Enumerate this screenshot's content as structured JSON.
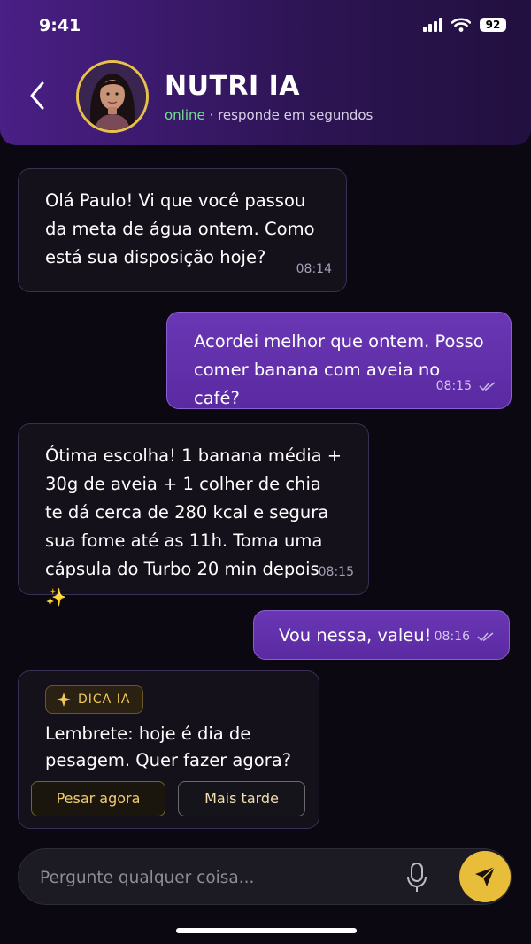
{
  "status_bar": {
    "time": "9:41",
    "battery": "92"
  },
  "header": {
    "contact_name": "NUTRI IA",
    "online_label": "online",
    "status_suffix": " · responde em segundos"
  },
  "messages": [
    {
      "sender": "ai",
      "text": "Olá Paulo! Vi que você passou da meta de água ontem. Como está sua disposição hoje?",
      "time": "08:14"
    },
    {
      "sender": "user",
      "text": "Acordei melhor que ontem. Posso comer banana com aveia no café?",
      "time": "08:15",
      "read": true
    },
    {
      "sender": "ai",
      "text": "Ótima escolha! 1 banana média + 30g de aveia + 1 colher de chia te dá cerca de 280 kcal e segura sua fome até as 11h. Toma uma cápsula do Turbo 20 min depois ✨",
      "time": "08:15"
    },
    {
      "sender": "user",
      "text": "Vou nessa, valeu!",
      "time": "08:16",
      "read": true
    }
  ],
  "tip_card": {
    "badge": "DICA IA",
    "text": "Lembrete: hoje é dia de pesagem. Quer fazer agora?",
    "primary_action": "Pesar agora",
    "secondary_action": "Mais tarde"
  },
  "composer": {
    "placeholder": "Pergunte qualquer coisa..."
  },
  "colors": {
    "accent_purple": "#5f2fa8",
    "accent_gold": "#e8bd3a",
    "online_green": "#6fe08e",
    "background": "#0b0812"
  },
  "icons": [
    "back-chevron-icon",
    "signal-icon",
    "wifi-icon",
    "battery-icon",
    "double-check-icon",
    "sparkle-icon",
    "microphone-icon",
    "send-icon"
  ]
}
